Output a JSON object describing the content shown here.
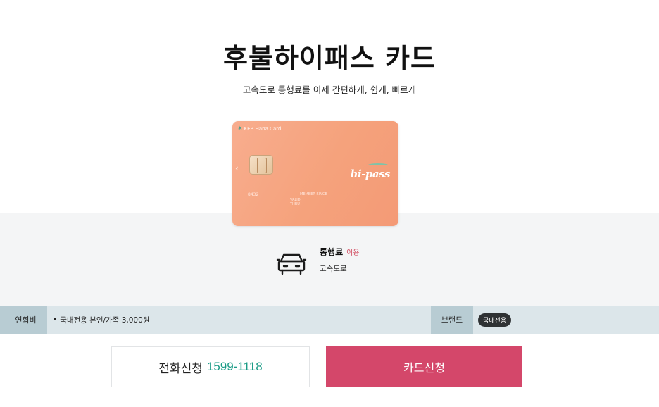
{
  "page": {
    "title": "후불하이패스 카드",
    "subtitle": "고속도로 통행료를 이제 간편하게, 쉽게, 빠르게"
  },
  "card": {
    "bank_name": "KEB Hana Card",
    "logo_text": "hi-pass",
    "number_fragment": "8432",
    "small_text_1": "MEMBER SINCE",
    "small_text_2": "VALID",
    "small_text_3": "THRU"
  },
  "usage": {
    "title": "통행료",
    "tag": "이용",
    "description": "고속도로",
    "icon": "car-icon"
  },
  "info": {
    "fee_label": "연회비",
    "fee_bullet": "•",
    "fee_value": "국내전용 본인/가족 3,000원",
    "brand_label": "브랜드",
    "brand_badge": "국내전용"
  },
  "buttons": {
    "phone_label": "전화신청",
    "phone_number": "1599-1118",
    "apply_label": "카드신청"
  },
  "colors": {
    "accent_pink": "#d4476a",
    "phone_teal": "#1a9b86",
    "card_peach": "#f5a27c",
    "info_bar": "#b8ccd3",
    "tag_red": "#d14b5f"
  }
}
